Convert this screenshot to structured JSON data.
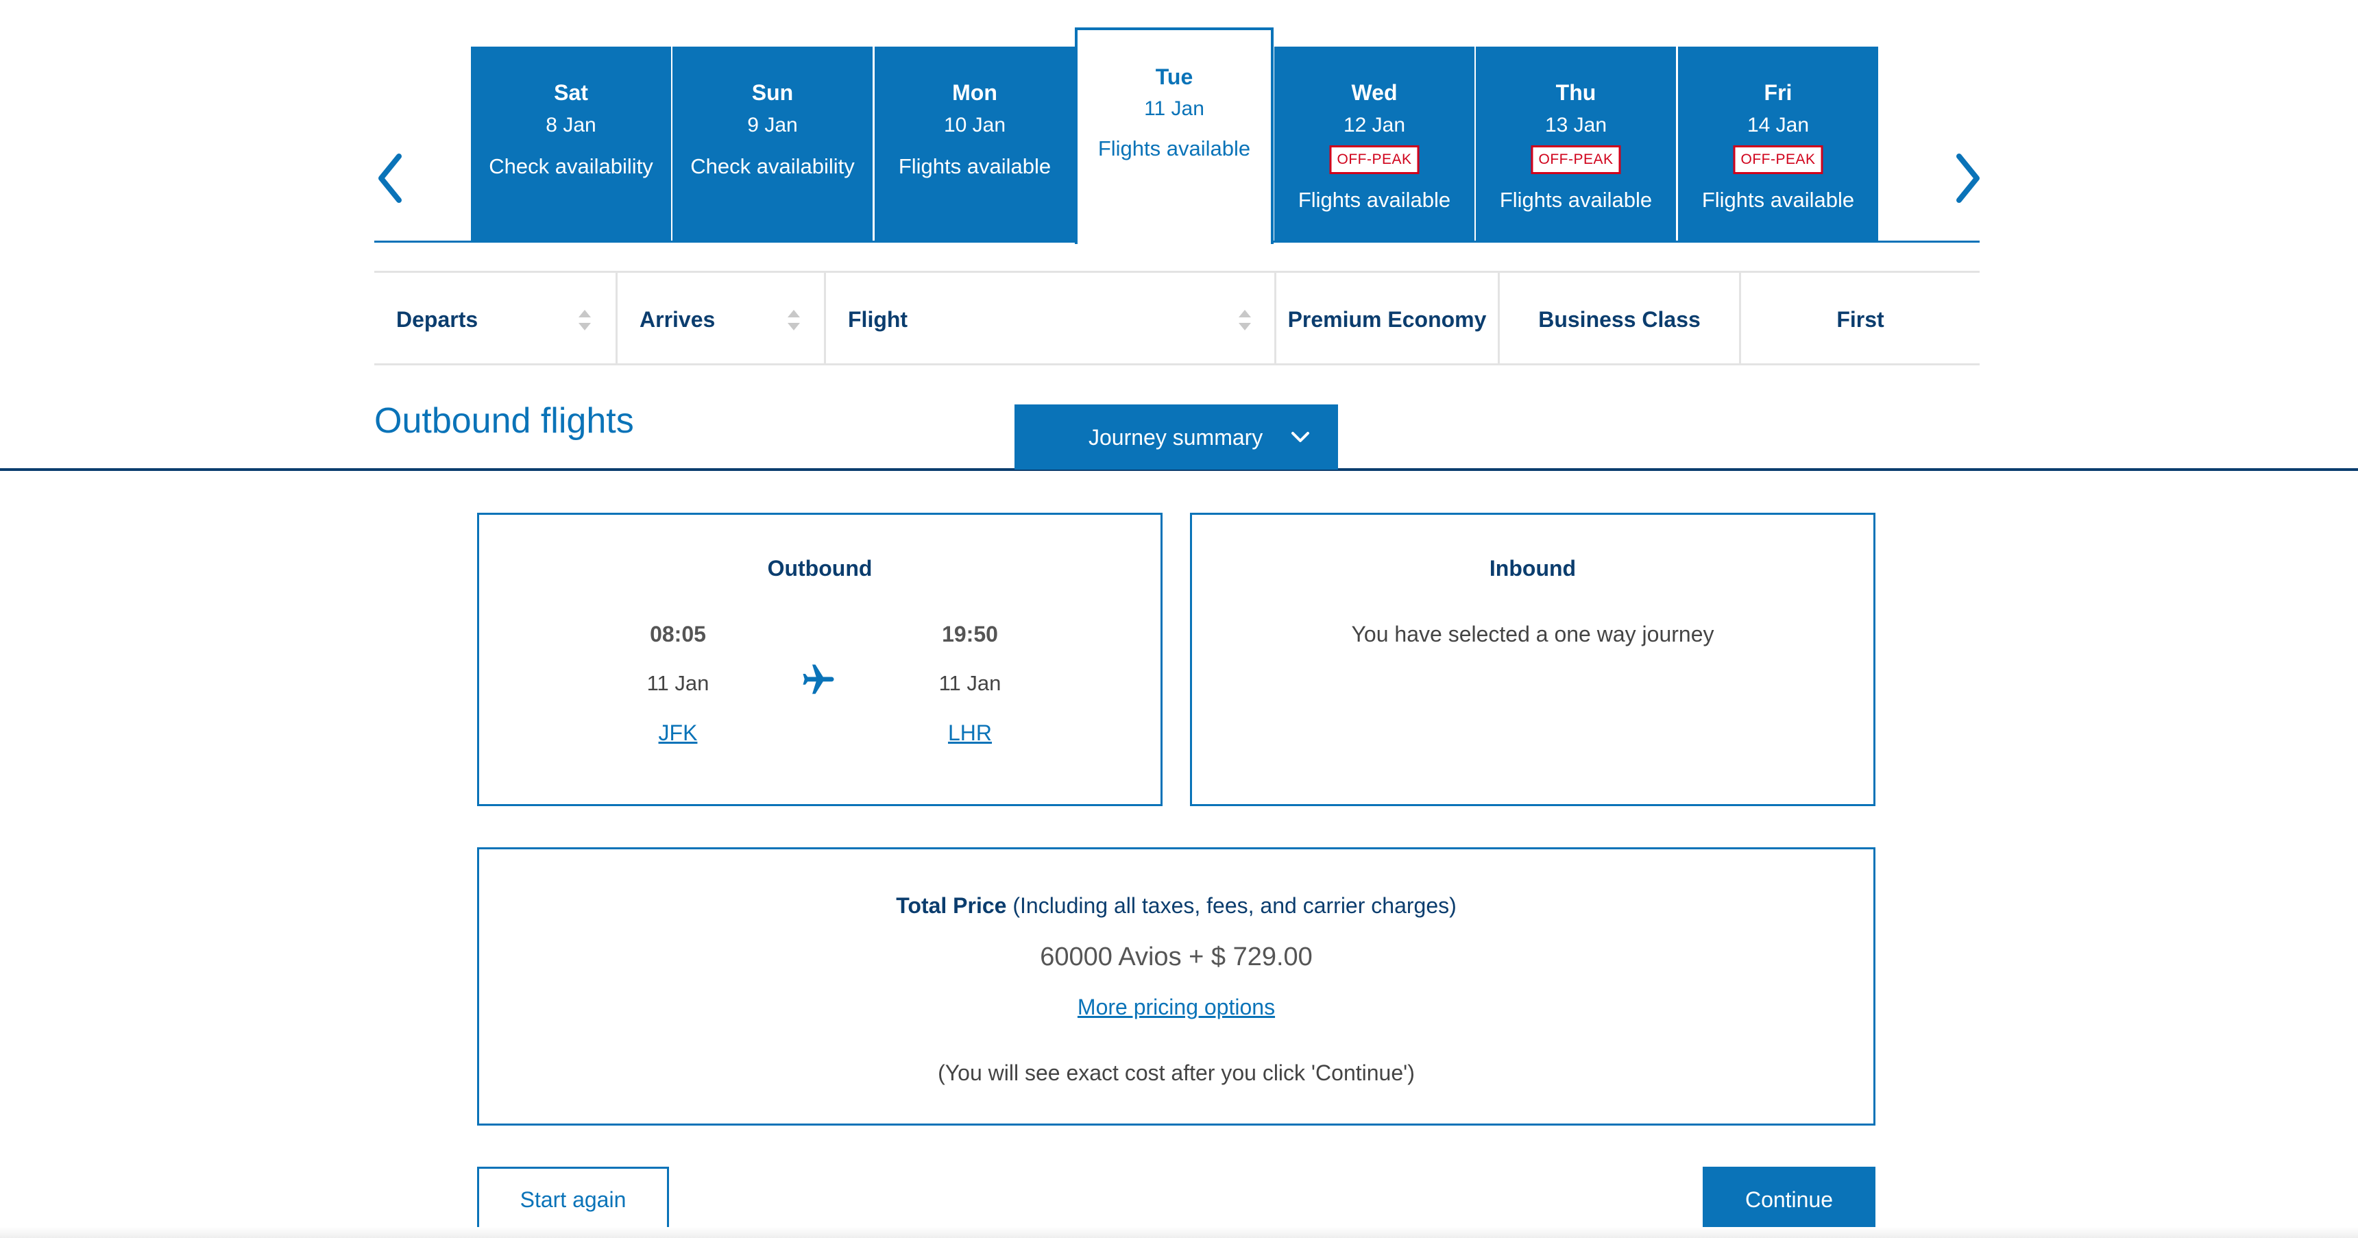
{
  "date_strip": {
    "days": [
      {
        "dow": "Sat",
        "date": "8 Jan",
        "status": "Check availability",
        "badge": ""
      },
      {
        "dow": "Sun",
        "date": "9 Jan",
        "status": "Check availability",
        "badge": ""
      },
      {
        "dow": "Mon",
        "date": "10 Jan",
        "status": "Flights available",
        "badge": ""
      },
      {
        "dow": "Tue",
        "date": "11 Jan",
        "status": "Flights available",
        "badge": "",
        "selected": true
      },
      {
        "dow": "Wed",
        "date": "12 Jan",
        "status": "Flights available",
        "badge": "OFF-PEAK"
      },
      {
        "dow": "Thu",
        "date": "13 Jan",
        "status": "Flights available",
        "badge": "OFF-PEAK"
      },
      {
        "dow": "Fri",
        "date": "14 Jan",
        "status": "Flights available",
        "badge": "OFF-PEAK"
      }
    ],
    "prev_icon": "chevron-left-icon",
    "next_icon": "chevron-right-icon"
  },
  "sort_header": {
    "departs": "Departs",
    "arrives": "Arrives",
    "flight": "Flight",
    "premium_economy": "Premium Economy",
    "business_class": "Business Class",
    "first": "First"
  },
  "outbound_header": {
    "title": "Outbound flights",
    "journey_summary": "Journey summary"
  },
  "outbound_card": {
    "title": "Outbound",
    "depart_time": "08:05",
    "depart_date": "11 Jan",
    "depart_airport": "JFK",
    "arrive_time": "19:50",
    "arrive_date": "11 Jan",
    "arrive_airport": "LHR",
    "icon": "airplane-icon"
  },
  "inbound_card": {
    "title": "Inbound",
    "message": "You have selected a one way journey"
  },
  "price_card": {
    "label_strong": "Total Price",
    "label_rest": "(Including all taxes, fees, and carrier charges)",
    "amount": "60000 Avios + $ 729.00",
    "more_options": "More pricing options",
    "note": "(You will see exact cost after you click 'Continue')"
  },
  "actions": {
    "start_again": "Start again",
    "continue": "Continue"
  },
  "colors": {
    "brand_blue": "#0a73b8",
    "navy": "#0b3d6e",
    "offpeak_red": "#d0021b"
  }
}
